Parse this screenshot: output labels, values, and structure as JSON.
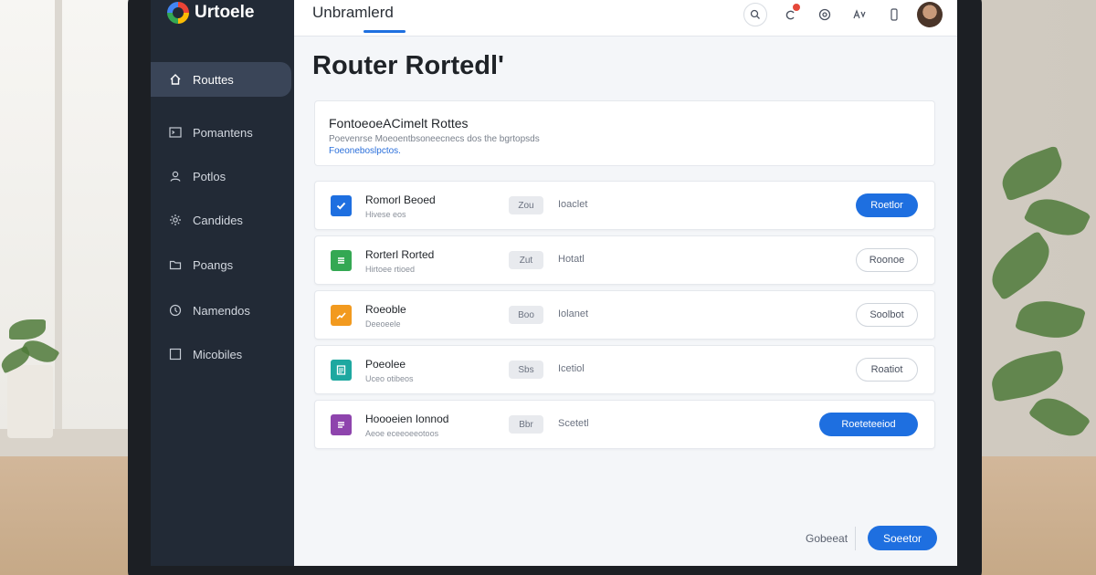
{
  "app": {
    "brand_name": "Urtoele",
    "top_tab": "Unbramlerd"
  },
  "topbar": {
    "icons": [
      "search-icon",
      "notification-icon",
      "settings-icon",
      "translate-icon",
      "mobile-icon",
      "avatar"
    ]
  },
  "sidebar": {
    "items": [
      {
        "label": "Routtes",
        "icon": "home-icon",
        "active": true
      },
      {
        "label": "Pomantens",
        "icon": "terminal-icon",
        "active": false
      },
      {
        "label": "Potlos",
        "icon": "user-icon",
        "active": false
      },
      {
        "label": "Candides",
        "icon": "gear-icon",
        "active": false
      },
      {
        "label": "Poangs",
        "icon": "folder-icon",
        "active": false
      },
      {
        "label": "Namendos",
        "icon": "clock-icon",
        "active": false
      },
      {
        "label": "Micobiles",
        "icon": "square-icon",
        "active": false
      }
    ]
  },
  "main": {
    "title": "Router Rortedl'",
    "intro": {
      "title": "FontoeoeACimelt Rottes",
      "description": "Poevenrse Moeoentbsoneecnecs dos the bgrtopsds",
      "link": "Foeoneboslpctos."
    },
    "rows": [
      {
        "title": "Romorl Beoed",
        "subtitle": "Hivese eos",
        "badge": "Zou",
        "status": "Ioaclet",
        "button": "Roetlor",
        "button_style": "primary",
        "icon": "checkbox-icon",
        "icon_color": "#1e6fe0"
      },
      {
        "title": "Rorterl Rorted",
        "subtitle": "Hirtoee rtioed",
        "badge": "Zut",
        "status": "Hotatl",
        "button": "Roonoe",
        "button_style": "outline",
        "icon": "list-icon",
        "icon_color": "#34a853"
      },
      {
        "title": "Roeoble",
        "subtitle": "Deeoeele",
        "badge": "Boo",
        "status": "Iolanet",
        "button": "Soolbot",
        "button_style": "outline",
        "icon": "chart-icon",
        "icon_color": "#f29a1f"
      },
      {
        "title": "Poeolee",
        "subtitle": "Uceo otibeos",
        "badge": "Sbs",
        "status": "Icetiol",
        "button": "Roatiot",
        "button_style": "outline",
        "icon": "document-icon",
        "icon_color": "#1ea8a0"
      },
      {
        "title": "Hoooeien Ionnod",
        "subtitle": "Aeoe eceeoeeotoos",
        "badge": "Bbr",
        "status": "Scetetl",
        "button": "Roeteteeiod",
        "button_style": "primary",
        "icon": "notes-icon",
        "icon_color": "#8e44ad"
      }
    ]
  },
  "footer": {
    "cancel_label": "Gobeeat",
    "primary_label": "Soeetor"
  }
}
